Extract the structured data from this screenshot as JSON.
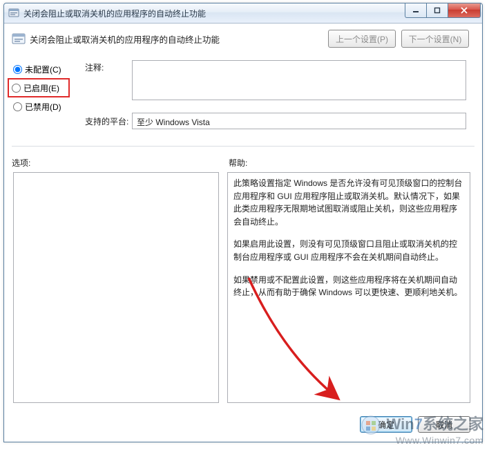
{
  "window": {
    "title": "关闭会阻止或取消关机的应用程序的自动终止功能"
  },
  "header": {
    "title": "关闭会阻止或取消关机的应用程序的自动终止功能",
    "prev_btn": "上一个设置(P)",
    "next_btn": "下一个设置(N)"
  },
  "radios": {
    "not_configured": "未配置(C)",
    "enabled": "已启用(E)",
    "disabled": "已禁用(D)",
    "selected": "not_configured"
  },
  "labels": {
    "comment": "注释:",
    "platform": "支持的平台:",
    "options": "选项:",
    "help": "帮助:"
  },
  "fields": {
    "comment_value": "",
    "platform_value": "至少 Windows Vista"
  },
  "help_paragraphs": [
    "此策略设置指定 Windows 是否允许没有可见顶级窗口的控制台应用程序和 GUI 应用程序阻止或取消关机。默认情况下，如果此类应用程序无限期地试图取消或阻止关机，则这些应用程序会自动终止。",
    "如果启用此设置，则没有可见顶级窗口且阻止或取消关机的控制台应用程序或 GUI 应用程序不会在关机期间自动终止。",
    "如果禁用或不配置此设置，则这些应用程序将在关机期间自动终止，从而有助于确保 Windows 可以更快速、更顺利地关机。"
  ],
  "buttons": {
    "ok": "确定",
    "cancel": "取消"
  },
  "watermark": {
    "brand_prefix": "Win",
    "brand_seven": "7",
    "brand_suffix": "系统之家",
    "url": "Www.Winwin7.com"
  }
}
